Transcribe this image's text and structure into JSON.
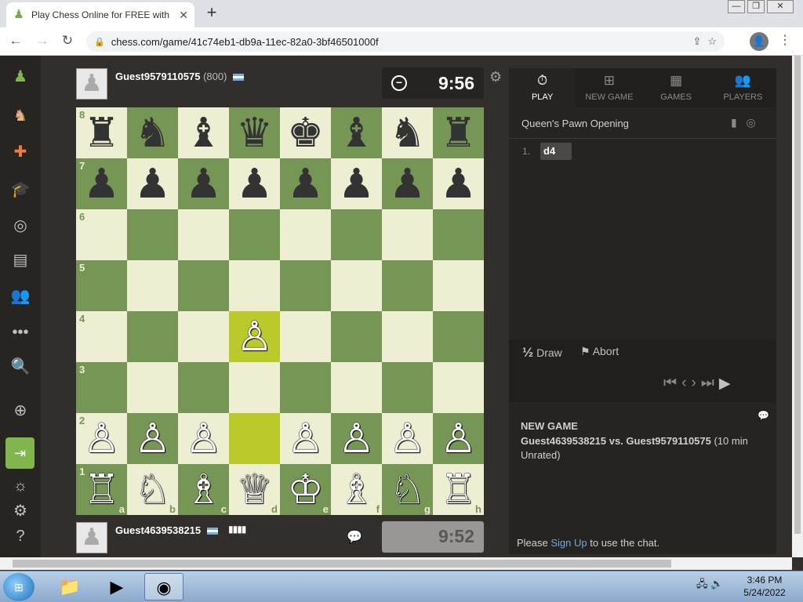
{
  "browser": {
    "tab_title": "Play Chess Online for FREE with F",
    "url": "chess.com/game/41c74eb1-db9a-11ec-82a0-3bf46501000f",
    "new_tab": "+",
    "tab_close": "✕",
    "win_minimize": "—",
    "win_restore": "❐",
    "win_close": "✕"
  },
  "sidebar": {
    "icons": [
      "pawn-logo-icon",
      "play-icon",
      "puzzles-icon",
      "learn-icon",
      "watch-icon",
      "news-icon",
      "social-icon",
      "more-icon",
      "search-icon",
      "add-friend-icon",
      "login-icon",
      "theme-icon",
      "settings-icon",
      "help-icon"
    ]
  },
  "top_player": {
    "name": "Guest9579110575",
    "rating": "(800)",
    "clock": "9:56"
  },
  "bottom_player": {
    "name": "Guest4639538215",
    "clock": "9:52"
  },
  "board": {
    "ranks": [
      "8",
      "7",
      "6",
      "5",
      "4",
      "3",
      "2",
      "1"
    ],
    "files": [
      "a",
      "b",
      "c",
      "d",
      "e",
      "f",
      "g",
      "h"
    ],
    "highlight": [
      "d2",
      "d4"
    ],
    "pieces": {
      "a8": "♜",
      "b8": "♞",
      "c8": "♝",
      "d8": "♛",
      "e8": "♚",
      "f8": "♝",
      "g8": "♞",
      "h8": "♜",
      "a7": "♟",
      "b7": "♟",
      "c7": "♟",
      "d7": "♟",
      "e7": "♟",
      "f7": "♟",
      "g7": "♟",
      "h7": "♟",
      "d4": "♙",
      "a2": "♙",
      "b2": "♙",
      "c2": "♙",
      "e2": "♙",
      "f2": "♙",
      "g2": "♙",
      "h2": "♙",
      "a1": "♖",
      "b1": "♘",
      "c1": "♗",
      "d1": "♕",
      "e1": "♔",
      "f1": "♗",
      "g1": "♘",
      "h1": "♖"
    },
    "colors": {
      "light": "#eeeed2",
      "dark": "#769656",
      "highlight": "#baca2b"
    }
  },
  "panel": {
    "tabs": [
      {
        "label": "PLAY",
        "icon": "timer-icon",
        "active": true
      },
      {
        "label": "NEW GAME",
        "icon": "plus-icon",
        "active": false
      },
      {
        "label": "GAMES",
        "icon": "board-icon",
        "active": false
      },
      {
        "label": "PLAYERS",
        "icon": "players-icon",
        "active": false
      }
    ],
    "opening": "Queen's Pawn Opening",
    "moves": [
      {
        "num": "1.",
        "white": "d4"
      }
    ],
    "draw_label": "Draw",
    "draw_glyph": "½",
    "abort_label": "Abort",
    "new_game_title": "NEW GAME",
    "new_game_players": "Guest4639538215 vs. Guest9579110575",
    "new_game_info": " (10 min Unrated)",
    "chat_prefix": "Please ",
    "chat_link": "Sign Up",
    "chat_suffix": " to use the chat."
  },
  "taskbar": {
    "time": "3:46 PM",
    "date": "5/24/2022"
  }
}
